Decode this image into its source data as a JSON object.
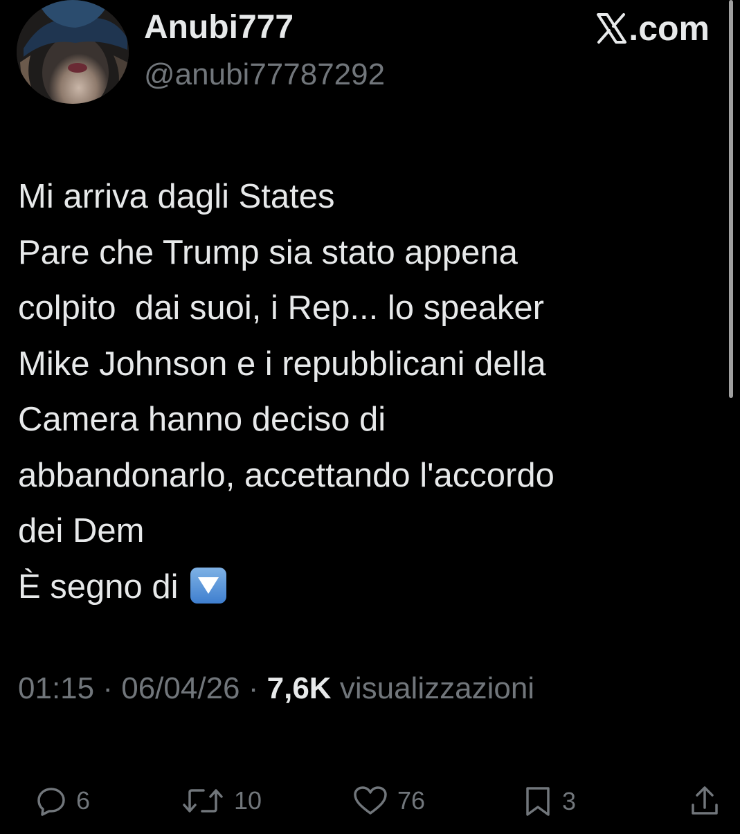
{
  "author": {
    "display_name": "Anubi777",
    "handle": "@anubi77787292",
    "avatar_icon": "avatar-woman-in-hat"
  },
  "source": {
    "label": ".com",
    "logo_icon": "x-logo"
  },
  "tweet": {
    "lines": [
      "Mi arriva dagli States",
      "Pare che Trump sia stato appena",
      "colpito  dai suoi, i Rep... lo speaker",
      "Mike Johnson e i repubblicani della",
      "Camera hanno deciso di",
      "abbandonarlo, accettando l'accordo",
      "dei Dem",
      "È segno di"
    ],
    "emoji": "arrow-down-button-emoji"
  },
  "meta": {
    "time": "01:15",
    "date": "06/04/26",
    "separator": "·",
    "views_count": "7,6K",
    "views_label": "visualizzazioni"
  },
  "actions": {
    "replies": "6",
    "reposts": "10",
    "likes": "76",
    "bookmarks": "3"
  },
  "colors": {
    "background": "#000000",
    "text_primary": "#e7e9ea",
    "text_secondary": "#71767b"
  }
}
